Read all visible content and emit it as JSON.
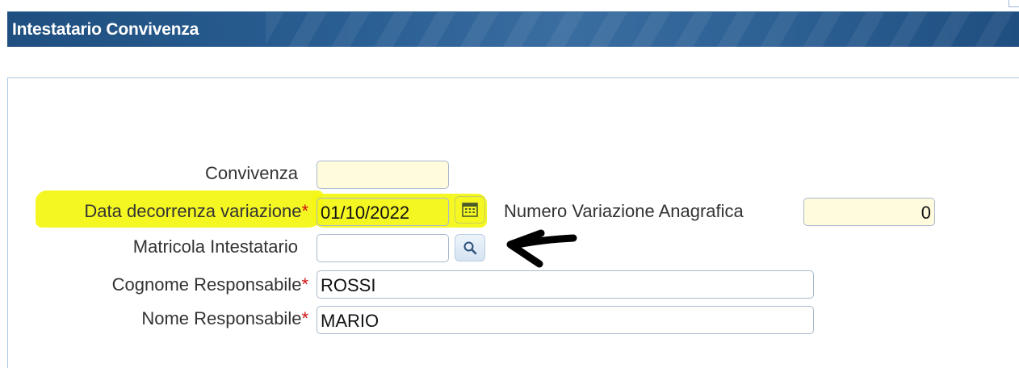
{
  "dialog": {
    "title": "Intestatario Convivenza"
  },
  "form": {
    "convivenza": {
      "label": "Convivenza",
      "value": ""
    },
    "data_decorrenza": {
      "label": "Data decorrenza variazione",
      "required_mark": "*",
      "value": "01/10/2022"
    },
    "numero_variazione": {
      "label": "Numero Variazione Anagrafica",
      "value": "0"
    },
    "matricola": {
      "label": "Matricola Intestatario",
      "value": ""
    },
    "cognome": {
      "label": "Cognome Responsabile",
      "required_mark": "*",
      "value": "ROSSI"
    },
    "nome": {
      "label": "Nome Responsabile",
      "required_mark": "*",
      "value": "MARIO"
    }
  },
  "icons": {
    "calendar": "calendar-icon",
    "search": "search-icon",
    "annotation_arrow": "arrow-left-icon"
  },
  "colors": {
    "title_bar": "#2a5f93",
    "readonly_field": "#fffbdc",
    "highlight": "#f4f60f",
    "required": "#d01010"
  }
}
